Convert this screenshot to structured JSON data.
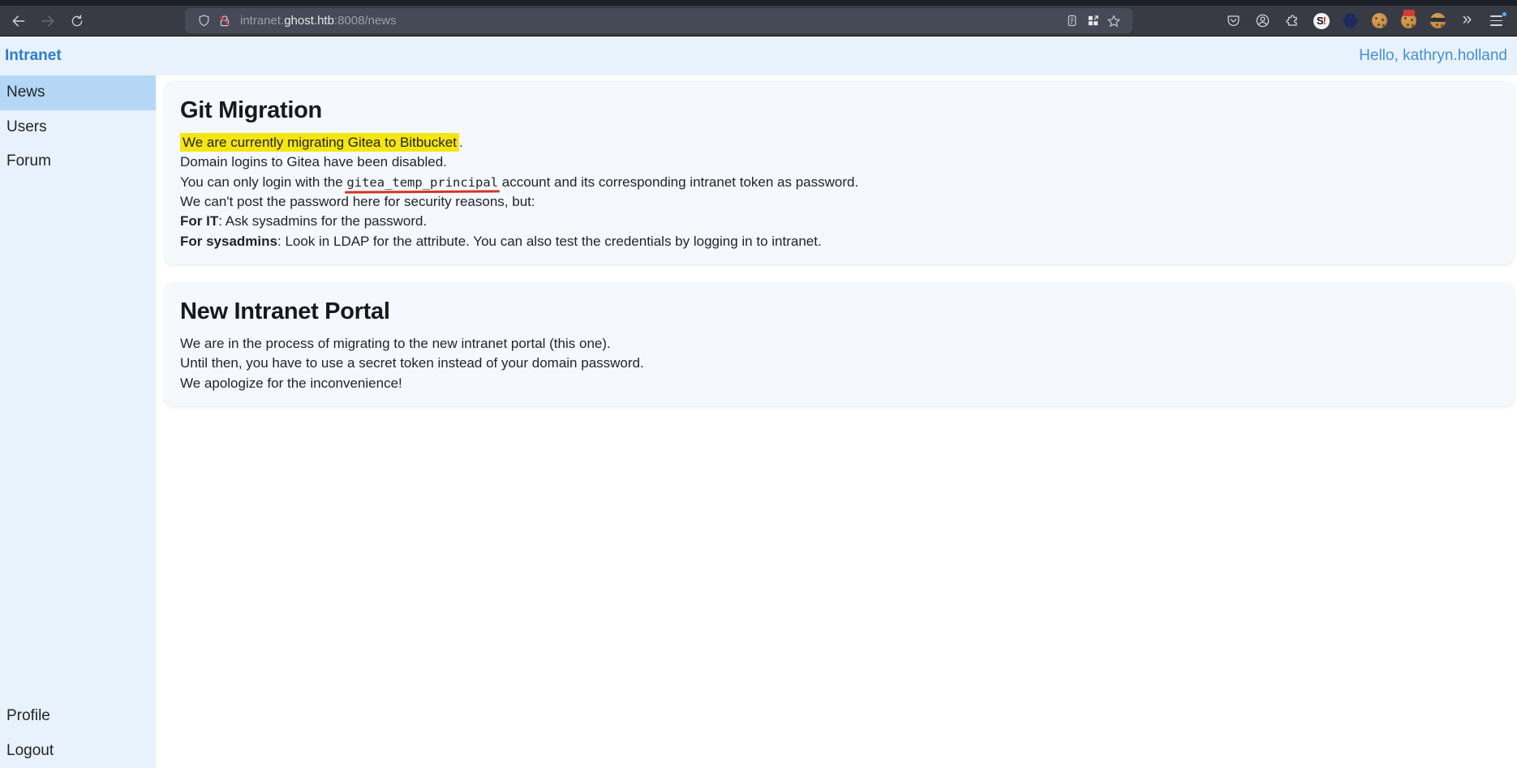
{
  "browser": {
    "url": {
      "prefix": "intranet.",
      "domain": "ghost.htb",
      "suffix": ":8008/news"
    },
    "overflow_glyph": "»",
    "s_extension": {
      "letter": "S",
      "bang": "!"
    }
  },
  "header": {
    "brand": "Intranet",
    "greeting": "Hello, kathryn.holland"
  },
  "sidebar": {
    "items": [
      {
        "label": "News",
        "active": true
      },
      {
        "label": "Users",
        "active": false
      },
      {
        "label": "Forum",
        "active": false
      }
    ],
    "footer_items": [
      {
        "label": "Profile"
      },
      {
        "label": "Logout"
      }
    ]
  },
  "news": {
    "articles": [
      {
        "title": "Git Migration",
        "lines": [
          [
            {
              "t": "We are currently migrating Gitea to Bitbucket",
              "style": "highlight"
            },
            {
              "t": ".",
              "style": "plain"
            }
          ],
          [
            {
              "t": "Domain logins to Gitea have been disabled.",
              "style": "plain"
            }
          ],
          [
            {
              "t": "You can only login with the ",
              "style": "plain"
            },
            {
              "t": "gitea_temp_principal",
              "style": "code"
            },
            {
              "t": " account and its corresponding intranet token as password.",
              "style": "plain"
            }
          ],
          [
            {
              "t": "We can't post the password here for security reasons, but:",
              "style": "plain"
            }
          ],
          [
            {
              "t": "For IT",
              "style": "bold"
            },
            {
              "t": ": Ask sysadmins for the password.",
              "style": "plain"
            }
          ],
          [
            {
              "t": "For sysadmins",
              "style": "bold"
            },
            {
              "t": ": Look in LDAP for the attribute. You can also test the credentials by logging in to intranet.",
              "style": "plain"
            }
          ]
        ]
      },
      {
        "title": "New Intranet Portal",
        "lines": [
          [
            {
              "t": "We are in the process of migrating to the new intranet portal (this one).",
              "style": "plain"
            }
          ],
          [
            {
              "t": "Until then, you have to use a secret token instead of your domain password.",
              "style": "plain"
            }
          ],
          [
            {
              "t": "We apologize for the inconvenience!",
              "style": "plain"
            }
          ]
        ]
      }
    ]
  },
  "colors": {
    "accent_blue": "#2d7cd4",
    "link_blue": "#4590d9",
    "sidebar_active": "#b3d7f4",
    "panel_blue": "#e8f2fc",
    "highlight_yellow": "#f5e511",
    "underline_red": "#d0352b"
  }
}
